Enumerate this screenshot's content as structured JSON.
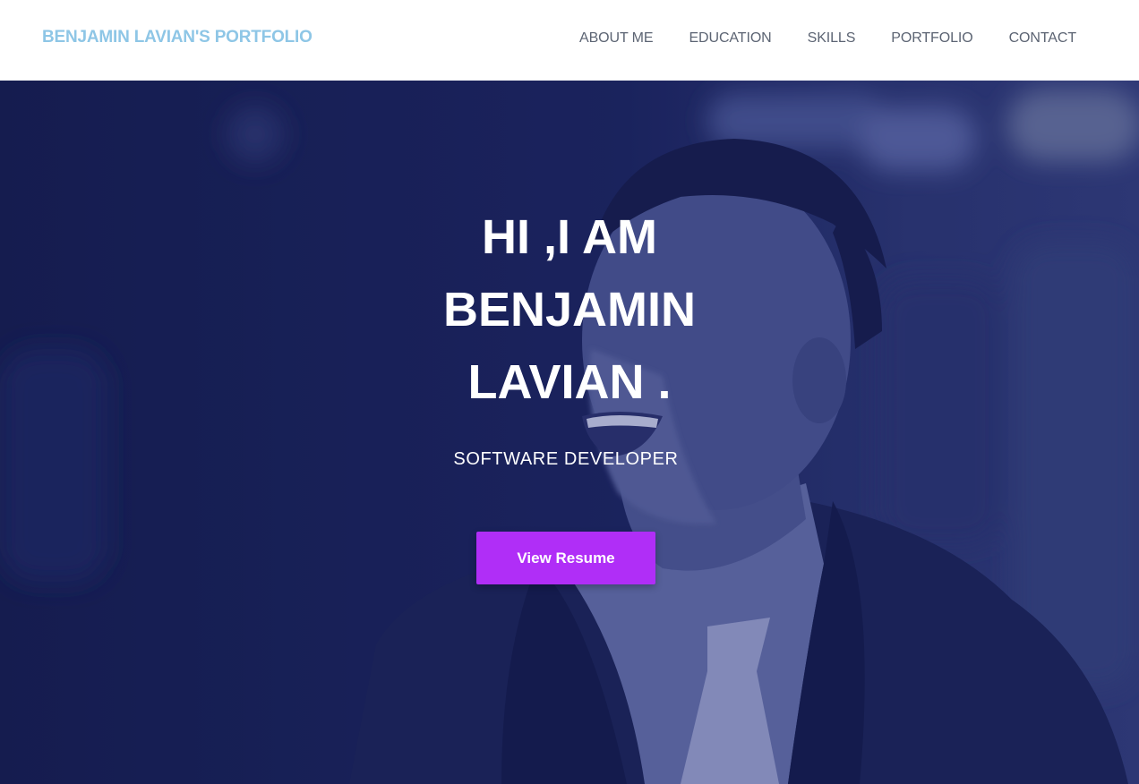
{
  "nav": {
    "brand": "BENJAMIN LAVIAN'S PORTFOLIO",
    "brand_color": "#8ec6e6",
    "links": [
      {
        "label": "ABOUT ME"
      },
      {
        "label": "EDUCATION"
      },
      {
        "label": "SKILLS"
      },
      {
        "label": "PORTFOLIO"
      },
      {
        "label": "CONTACT"
      }
    ]
  },
  "hero": {
    "title": "HI ,I AM BENJAMIN LAVIAN .",
    "subtitle": "SOFTWARE DEVELOPER",
    "button_label": "View Resume",
    "button_color": "#b02ef7",
    "overlay_color": "#172052"
  }
}
